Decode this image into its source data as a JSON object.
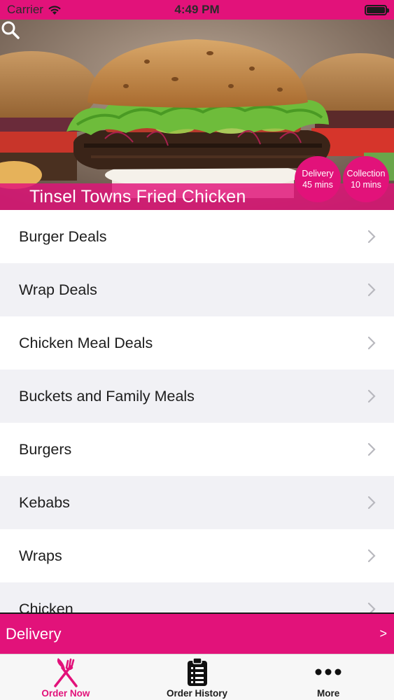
{
  "status_bar": {
    "carrier": "Carrier",
    "time": "4:49 PM",
    "wifi_icon": "wifi-icon",
    "battery_icon": "battery-icon"
  },
  "header": {
    "restaurant_name": "Tinsel Towns Fried Chicken",
    "search_icon": "search-icon",
    "delivery_badge": {
      "label": "Delivery",
      "time": "45 mins"
    },
    "collection_badge": {
      "label": "Collection",
      "time": "10 mins"
    }
  },
  "menu": {
    "categories": [
      {
        "label": "Burger Deals"
      },
      {
        "label": "Wrap Deals"
      },
      {
        "label": "Chicken Meal Deals"
      },
      {
        "label": "Buckets and Family Meals"
      },
      {
        "label": "Burgers"
      },
      {
        "label": "Kebabs"
      },
      {
        "label": "Wraps"
      },
      {
        "label": "Chicken"
      }
    ]
  },
  "order_bar": {
    "mode": "Delivery",
    "arrow": ">"
  },
  "tabs": [
    {
      "label": "Order Now",
      "icon": "fork-knife-icon",
      "active": true
    },
    {
      "label": "Order History",
      "icon": "clipboard-list-icon",
      "active": false
    },
    {
      "label": "More",
      "icon": "more-dots-icon",
      "active": false
    }
  ],
  "colors": {
    "brand": "#e2127a",
    "row_alt": "#f1f1f5",
    "text": "#1d1d1d"
  }
}
